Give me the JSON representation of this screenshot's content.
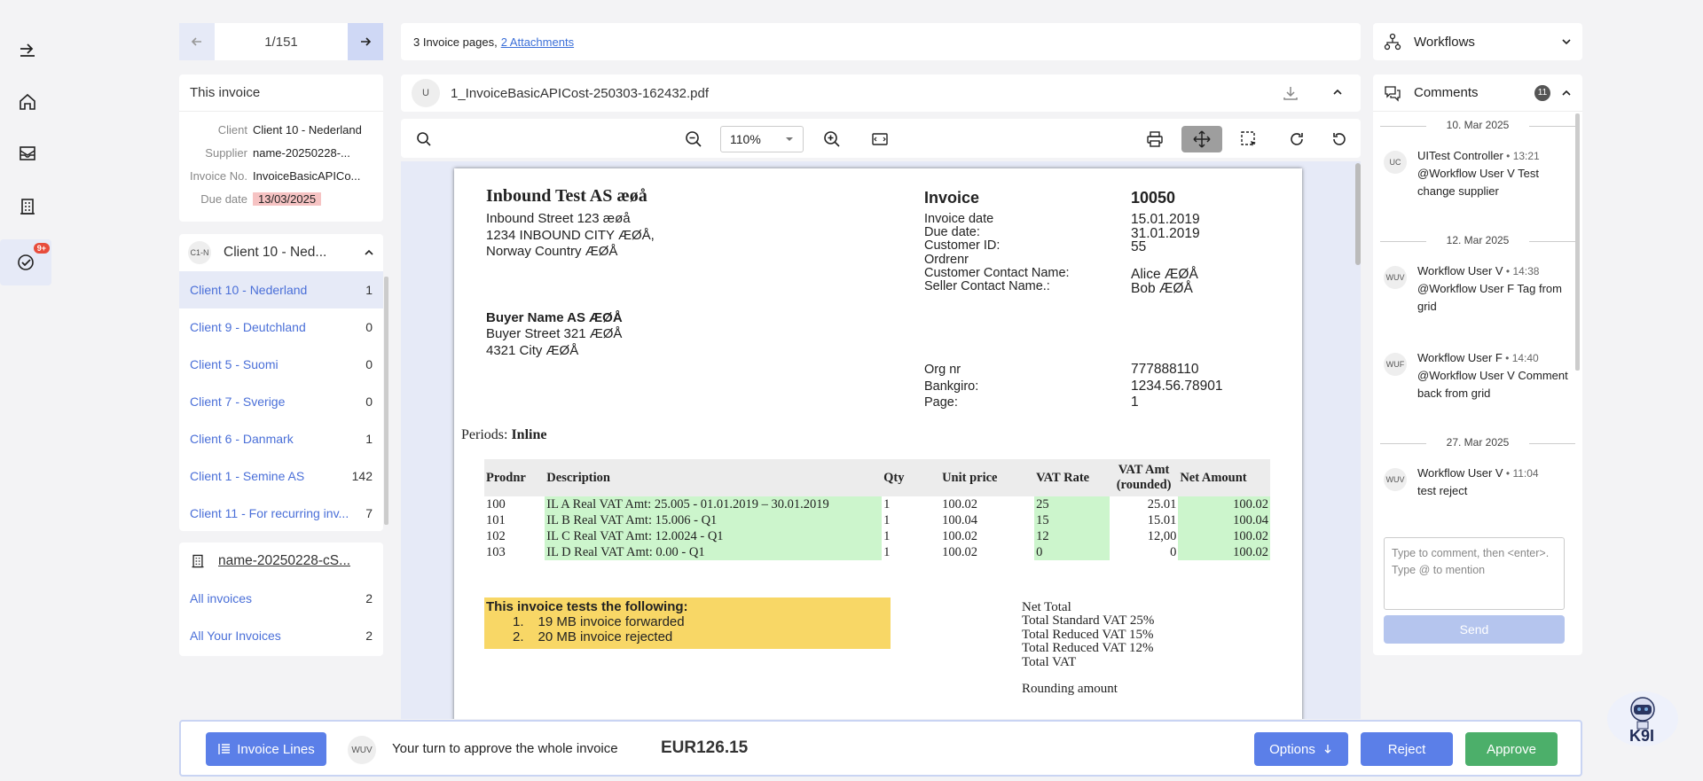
{
  "pager": {
    "count": "1/151"
  },
  "this_invoice": {
    "title": "This invoice",
    "rows": [
      {
        "key": "Client",
        "value": "Client 10 - Nederland"
      },
      {
        "key": "Supplier",
        "value": "name-20250228-..."
      },
      {
        "key": "Invoice No.",
        "value": "InvoiceBasicAPICo..."
      },
      {
        "key": "Due date",
        "value": "13/03/2025"
      }
    ]
  },
  "clients": {
    "avatar": "C1-N",
    "title": "Client 10 - Ned...",
    "items": [
      {
        "name": "Client 10 - Nederland",
        "count": "1"
      },
      {
        "name": "Client 9 - Deutchland",
        "count": "0"
      },
      {
        "name": "Client 5 - Suomi",
        "count": "0"
      },
      {
        "name": "Client 7 - Sverige",
        "count": "0"
      },
      {
        "name": "Client 6 - Danmark",
        "count": "1"
      },
      {
        "name": "Client 1 - Semine AS",
        "count": "142"
      },
      {
        "name": "Client 11 - For recurring inv...",
        "count": "7"
      }
    ]
  },
  "supplier": {
    "title": "name-20250228-cS...",
    "items": [
      {
        "name": "All invoices",
        "count": "2"
      },
      {
        "name": "All Your Invoices",
        "count": "2"
      }
    ]
  },
  "rail": {
    "badge": "9+"
  },
  "attach_bar": {
    "pages_text": "3 Invoice pages,",
    "attachments_link": "2 Attachments"
  },
  "doc": {
    "avatar": "U",
    "filename": "1_InvoiceBasicAPICost-250303-162432.pdf"
  },
  "toolbar": {
    "zoom": "110%"
  },
  "invoice_page": {
    "seller_name": "Inbound Test AS æøå",
    "seller_addr": [
      "Inbound Street 123 æøå",
      "1234 INBOUND CITY ÆØÅ,",
      "Norway Country ÆØÅ"
    ],
    "title": "Invoice",
    "number": "10050",
    "meta_labels": [
      "Invoice date",
      "Due date:",
      "Customer ID:",
      "Ordrenr",
      "Customer Contact Name:",
      "Seller Contact Name.:"
    ],
    "meta_values": [
      "15.01.2019",
      "31.01.2019",
      "55",
      "",
      "Alice ÆØÅ",
      "Bob ÆØÅ"
    ],
    "buyer_name": "Buyer Name AS ÆØÅ",
    "buyer_addr": [
      "Buyer Street 321 ÆØÅ",
      "4321 City ÆØÅ"
    ],
    "org_labels": [
      "Org nr",
      "Bankgiro:",
      "Page:"
    ],
    "org_values": [
      "777888110",
      "1234.56.78901",
      "1"
    ],
    "periods_label": "Periods:",
    "periods_value": "Inline",
    "table_headers": [
      "Prodnr",
      "Description",
      "Qty",
      "Unit price",
      "VAT Rate",
      "VAT Amt (rounded)",
      "Net Amount"
    ],
    "lines": [
      [
        "100",
        "IL A Real VAT Amt: 25.005   - 01.01.2019 – 30.01.2019",
        "1",
        "100.02",
        "25",
        "25.01",
        "100.02"
      ],
      [
        "101",
        "IL B Real VAT Amt: 15.006    - Q1",
        "1",
        "100.04",
        "15",
        "15.01",
        "100.04"
      ],
      [
        "102",
        "IL C Real VAT Amt: 12.0024    - Q1",
        "1",
        "100.02",
        "12",
        "12,00",
        "100.02"
      ],
      [
        "103",
        "IL D Real VAT Amt: 0.00    - Q1",
        "1",
        "100.02",
        "0",
        "0",
        "100.02"
      ]
    ],
    "tests_title": "This invoice tests the following:",
    "tests": [
      "19 MB invoice forwarded",
      "20 MB invoice rejected"
    ],
    "totals": [
      "Net Total",
      "Total Standard VAT 25%",
      "Total Reduced VAT 15%",
      "Total Reduced VAT 12%",
      "Total VAT",
      "",
      "Rounding amount"
    ]
  },
  "workflows": {
    "title": "Workflows"
  },
  "comments": {
    "title": "Comments",
    "count": "11",
    "items": [
      {
        "date": "10. Mar 2025",
        "avatar": "UC",
        "author": "UITest Controller",
        "time": "13:21",
        "mention": "@Workflow User V",
        "text": "Test change supplier"
      },
      {
        "date": "12. Mar 2025",
        "avatar": "WUV",
        "author": "Workflow User V",
        "time": "14:38",
        "mention": "@Workflow User F",
        "text": "Tag from grid"
      },
      {
        "date": "",
        "avatar": "WUF",
        "author": "Workflow User F",
        "time": "14:40",
        "mention": "@Workflow User V",
        "text": "Comment back from grid"
      },
      {
        "date": "27. Mar 2025",
        "avatar": "WUV",
        "author": "Workflow User V",
        "time": "11:04",
        "mention": "",
        "text": "test reject"
      }
    ],
    "input_placeholder": "Type to comment, then <enter>. Type @ to mention",
    "send": "Send"
  },
  "bottom": {
    "lines_button": "Invoice Lines",
    "avatar": "WUV",
    "turn_text": "Your turn to approve the whole invoice",
    "amount": "EUR126.15",
    "options": "Options",
    "reject": "Reject",
    "approve": "Approve"
  },
  "bot": {
    "label": "K9I"
  },
  "colors": {
    "accent": "#5b7fe8",
    "approve": "#4caf6a",
    "due_pill": "#f6c3c3",
    "highlight_green": "#ccf5cc",
    "highlight_yellow": "#f8d766"
  }
}
